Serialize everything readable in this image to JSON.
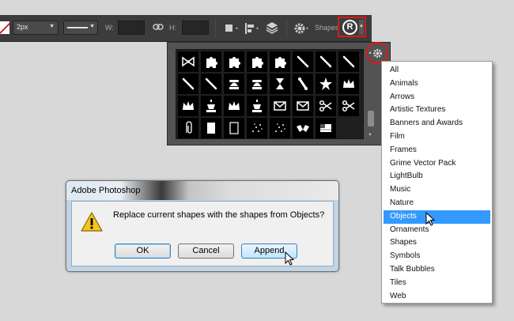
{
  "options_bar": {
    "stroke_width": "2px",
    "width_label": "W:",
    "height_label": "H:",
    "shapes_label": "Shapes:",
    "current_shape": "registered-trademark"
  },
  "shapes_panel": {
    "shapes": [
      "bow",
      "puzzle-piece-1",
      "puzzle-piece-2",
      "puzzle-piece-3",
      "puzzle-piece-4",
      "stick-1",
      "stick-2",
      "stick-3",
      "stick-4",
      "stick-5",
      "rotary-phone",
      "telephone",
      "hourglass",
      "bone",
      "sheriff-star",
      "crown-1",
      "crown-2",
      "chess-king-1",
      "crown-3",
      "chess-king-2",
      "envelope-1",
      "envelope-2",
      "scissors-1",
      "scissors-2",
      "paperclip",
      "stamp",
      "frame",
      "sparkles-1",
      "sparkles-2",
      "bat-wing",
      "flag"
    ]
  },
  "menu": {
    "items": [
      "All",
      "Animals",
      "Arrows",
      "Artistic Textures",
      "Banners and Awards",
      "Film",
      "Frames",
      "Grime Vector Pack",
      "LightBulb",
      "Music",
      "Nature",
      "Objects",
      "Ornaments",
      "Shapes",
      "Symbols",
      "Talk Bubbles",
      "Tiles",
      "Web"
    ],
    "selected": "Objects"
  },
  "dialog": {
    "title": "Adobe Photoshop",
    "message": "Replace current shapes with the shapes from Objects?",
    "ok_label": "OK",
    "cancel_label": "Cancel",
    "append_label": "Append"
  },
  "colors": {
    "highlight_red": "#d81a1a",
    "menu_selection": "#3399ff",
    "toolbar_bg": "#3c3c3c"
  }
}
